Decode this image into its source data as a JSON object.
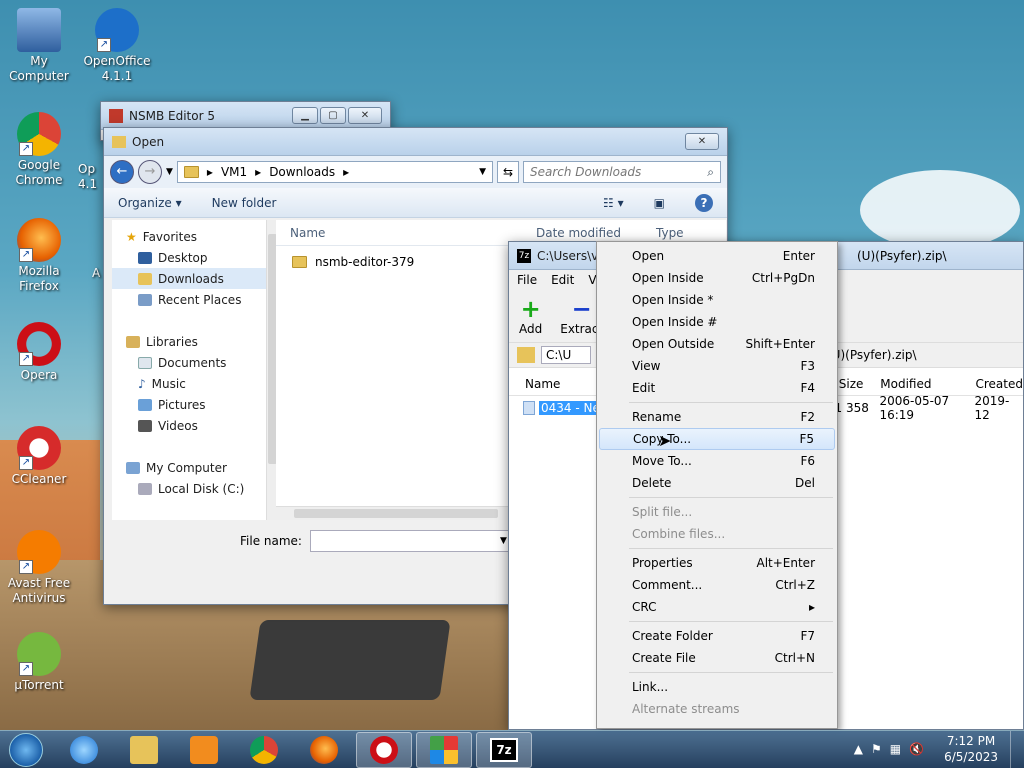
{
  "desktop": {
    "icons": [
      {
        "label": "My Computer"
      },
      {
        "label": "OpenOffice 4.1.1"
      },
      {
        "label": "Google Chrome"
      },
      {
        "label": "Mozilla Firefox"
      },
      {
        "label": "Opera"
      },
      {
        "label": "CCleaner"
      },
      {
        "label": "Avast Free Antivirus"
      },
      {
        "label": "µTorrent"
      },
      {
        "label": "Op 4.1"
      },
      {
        "label": "A"
      }
    ]
  },
  "nsmb_window": {
    "title": "NSMB Editor 5"
  },
  "open_dialog": {
    "title": "Open",
    "breadcrumb": [
      "VM1",
      "Downloads"
    ],
    "search_placeholder": "Search Downloads",
    "organize_label": "Organize ▾",
    "new_folder_label": "New folder",
    "nav": {
      "favorites": "Favorites",
      "desktop": "Desktop",
      "downloads": "Downloads",
      "recent": "Recent Places",
      "libraries": "Libraries",
      "documents": "Documents",
      "music": "Music",
      "pictures": "Pictures",
      "videos": "Videos",
      "my_computer": "My Computer",
      "local_disk": "Local Disk (C:)"
    },
    "columns": {
      "name": "Name",
      "date_modified": "Date modified",
      "type": "Type"
    },
    "files": [
      {
        "name": "nsmb-editor-379"
      }
    ],
    "file_name_label": "File name:",
    "file_name_value": ""
  },
  "sevenzip": {
    "title_left": "C:\\Users\\v",
    "title_right": "(U)(Psyfer).zip\\",
    "menu": [
      "File",
      "Edit",
      "V"
    ],
    "tools": {
      "add": "Add",
      "extract": "Extract"
    },
    "path_left": "C:\\U",
    "path_right": "(U)(Psyfer).zip\\",
    "columns": {
      "name": "Name",
      "packed_size": "ed Size",
      "modified": "Modified",
      "created": "Created"
    },
    "row": {
      "name": "0434 - New",
      "packed_size": "501 358",
      "modified": "2006-05-07 16:19",
      "created": "2019-12"
    }
  },
  "context_menu": {
    "items": [
      {
        "label": "Open",
        "shortcut": "Enter"
      },
      {
        "label": "Open Inside",
        "shortcut": "Ctrl+PgDn"
      },
      {
        "label": "Open Inside *",
        "shortcut": ""
      },
      {
        "label": "Open Inside #",
        "shortcut": ""
      },
      {
        "label": "Open Outside",
        "shortcut": "Shift+Enter"
      },
      {
        "label": "View",
        "shortcut": "F3"
      },
      {
        "label": "Edit",
        "shortcut": "F4"
      },
      {
        "label": "Rename",
        "shortcut": "F2"
      },
      {
        "label": "Copy To...",
        "shortcut": "F5"
      },
      {
        "label": "Move To...",
        "shortcut": "F6"
      },
      {
        "label": "Delete",
        "shortcut": "Del"
      },
      {
        "label": "Split file...",
        "shortcut": ""
      },
      {
        "label": "Combine files...",
        "shortcut": ""
      },
      {
        "label": "Properties",
        "shortcut": "Alt+Enter"
      },
      {
        "label": "Comment...",
        "shortcut": "Ctrl+Z"
      },
      {
        "label": "CRC",
        "shortcut": "▸"
      },
      {
        "label": "Create Folder",
        "shortcut": "F7"
      },
      {
        "label": "Create File",
        "shortcut": "Ctrl+N"
      },
      {
        "label": "Link...",
        "shortcut": ""
      },
      {
        "label": "Alternate streams",
        "shortcut": ""
      }
    ]
  },
  "taskbar": {
    "time": "7:12 PM",
    "date": "6/5/2023",
    "sevenzip_label": "7z"
  },
  "colors": {
    "accent": "#3399ff",
    "selection": "#3399ff",
    "opera_red": "#cc0f16"
  }
}
